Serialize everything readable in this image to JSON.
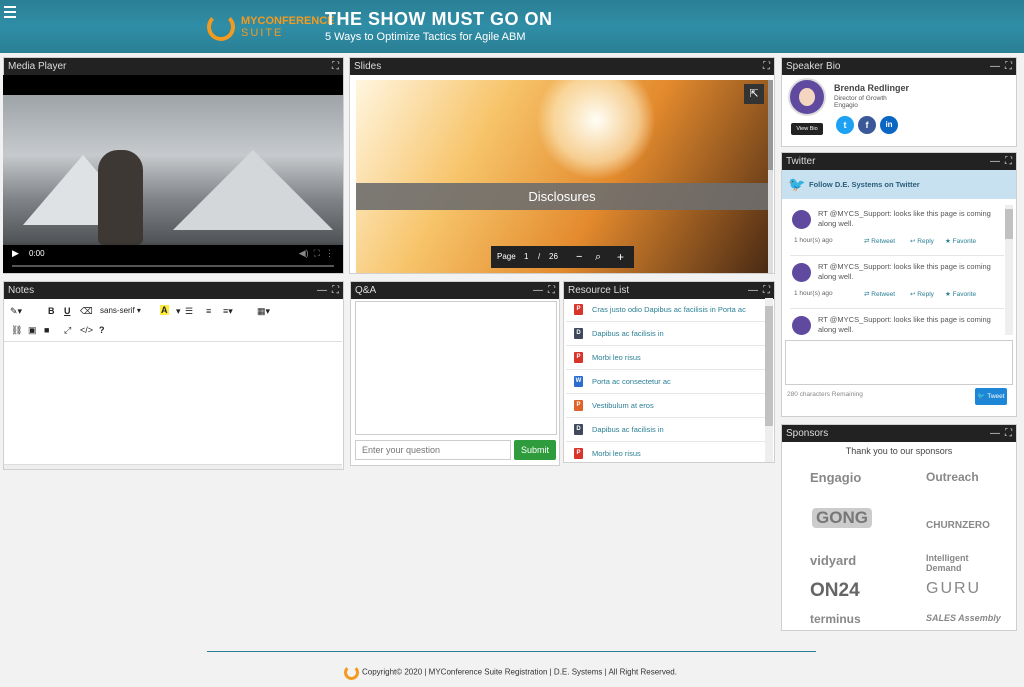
{
  "header": {
    "logo_line1": "MYCONFERENCE",
    "logo_line2": "SUITE",
    "title": "THE SHOW MUST GO ON",
    "subtitle": "5 Ways to Optimize Tactics for Agile ABM"
  },
  "panels": {
    "media": "Media Player",
    "slides": "Slides",
    "speaker": "Speaker Bio",
    "twitter": "Twitter",
    "notes": "Notes",
    "qa": "Q&A",
    "resources": "Resource List",
    "sponsors": "Sponsors"
  },
  "video": {
    "time": "0:00",
    "progress": 0
  },
  "slides": {
    "slide_title": "Disclosures",
    "page_label": "Page",
    "current_page": "1",
    "separator": "/",
    "total_pages": "26"
  },
  "notes": {
    "font_select": "sans-serif"
  },
  "qa": {
    "placeholder": "Enter your question",
    "submit": "Submit"
  },
  "resources": [
    {
      "type": "pdf",
      "title": "Cras justo odio Dapibus ac facilisis in Porta ac"
    },
    {
      "type": "doc",
      "title": "Dapibus ac facilisis in"
    },
    {
      "type": "pdf",
      "title": "Morbi leo risus"
    },
    {
      "type": "word",
      "title": "Porta ac consectetur ac"
    },
    {
      "type": "ppt",
      "title": "Vestibulum at eros"
    },
    {
      "type": "doc",
      "title": "Dapibus ac facilisis in"
    },
    {
      "type": "pdf",
      "title": "Morbi leo risus"
    }
  ],
  "speaker": {
    "name": "Brenda Redlinger",
    "title": "Director of Growth",
    "company": "Engagio",
    "view_bio": "View Bio"
  },
  "twitter": {
    "follow": "Follow D.E. Systems on Twitter",
    "tweets": [
      {
        "text": "RT @MYCS_Support: looks like this page is coming along well.",
        "time": "1 hour(s) ago",
        "retweet": "Retweet",
        "reply": "Reply",
        "favorite": "Favorite"
      },
      {
        "text": "RT @MYCS_Support: looks like this page is coming along well.",
        "time": "1 hour(s) ago",
        "retweet": "Retweet",
        "reply": "Reply",
        "favorite": "Favorite"
      },
      {
        "text": "RT @MYCS_Support: looks like this page is coming along well.",
        "time": "",
        "retweet": "",
        "reply": "",
        "favorite": ""
      }
    ],
    "remaining": "280 characters Remaining",
    "tweet_button": "Tweet"
  },
  "sponsors": {
    "thanks": "Thank you to our sponsors",
    "logos": [
      "Engagio",
      "Outreach",
      "GONG",
      "CHURNZERO",
      "vidyard",
      "Intelligent Demand",
      "ON24",
      "GURU",
      "terminus",
      "SALES Assembly"
    ]
  },
  "footer": {
    "text": "Copyright© 2020 | MYConference Suite Registration | D.E. Systems | All Right Reserved."
  },
  "colors": {
    "brand_teal": "#2a7f95",
    "brand_orange": "#f39a1f",
    "submit_green": "#2e9c3d",
    "twitter_blue": "#1da1f2"
  }
}
